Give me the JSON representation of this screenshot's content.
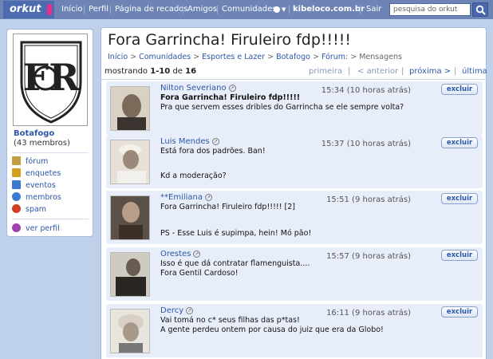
{
  "topbar": {
    "logo": "orkut",
    "nav": [
      "Início",
      "Perfil",
      "Página de recados",
      "Amigos",
      "Comunidades"
    ],
    "site": "kibeloco.com.br",
    "logout": "Sair",
    "search_placeholder": "pesquisa do orkut",
    "colors": {
      "bar": "#6d84b4",
      "logo_bg": "#4d6bb0",
      "logo_accent": "#e62e8a"
    }
  },
  "sidebar": {
    "club_name": "Botafogo",
    "members": "(43 membros)",
    "items": [
      {
        "label": "fórum",
        "icon": "forum-icon",
        "color": "#c0a040"
      },
      {
        "label": "enquetes",
        "icon": "poll-icon",
        "color": "#d0a020"
      },
      {
        "label": "eventos",
        "icon": "calendar-icon",
        "color": "#3a7bd0"
      },
      {
        "label": "membros",
        "icon": "members-icon",
        "color": "#3a7bd0"
      },
      {
        "label": "spam",
        "icon": "spam-icon",
        "color": "#d04020"
      }
    ],
    "profile_link": "ver perfil"
  },
  "main": {
    "title": "Fora Garrincha! Firuleiro fdp!!!!!",
    "breadcrumb": [
      "Início",
      "Comunidades",
      "Esportes e Lazer",
      "Botafogo",
      "Fórum:",
      "Mensagens"
    ],
    "pager": {
      "mostrando": "mostrando",
      "range": "1-10",
      "de": "de",
      "total": "16",
      "first": "primeira",
      "prev": "< anterior",
      "next": "próxima >",
      "last": "última"
    },
    "delete_label": "excluir",
    "posts": [
      {
        "author": "Nilton Severiano",
        "time": "15:34 (10 horas atrás)",
        "lines": [
          {
            "text": "Fora Garrincha! Firuleiro fdp!!!!!",
            "bold": true
          },
          {
            "text": "Pra que servem esses dribles do Garrincha se ele sempre volta?",
            "bold": false
          }
        ]
      },
      {
        "author": "Luis Mendes",
        "time": "15:37 (10 horas atrás)",
        "lines": [
          {
            "text": "Está fora dos padrões. Ban!",
            "bold": false
          },
          {
            "text": "Kd a moderação?",
            "bold": false
          }
        ]
      },
      {
        "author": "**Emiliana",
        "time": "15:51 (9 horas atrás)",
        "lines": [
          {
            "text": "Fora Garrincha! Firuleiro fdp!!!!! [2]",
            "bold": false
          },
          {
            "text": "PS - Esse Luis é supimpa, hein! Mó pão!",
            "bold": false
          }
        ]
      },
      {
        "author": "Orestes",
        "time": "15:57 (9 horas atrás)",
        "lines": [
          {
            "text": "Isso é que dá contratar flamenguista....",
            "bold": false
          },
          {
            "text": "Fora Gentil Cardoso!",
            "bold": false
          }
        ]
      },
      {
        "author": "Dercy",
        "time": "16:11 (9 horas atrás)",
        "lines": [
          {
            "text": "Vai tomá no c* seus filhas das p*tas!",
            "bold": false
          },
          {
            "text": "A gente perdeu ontem por causa do juiz que era da Globo!",
            "bold": false
          }
        ]
      }
    ]
  }
}
